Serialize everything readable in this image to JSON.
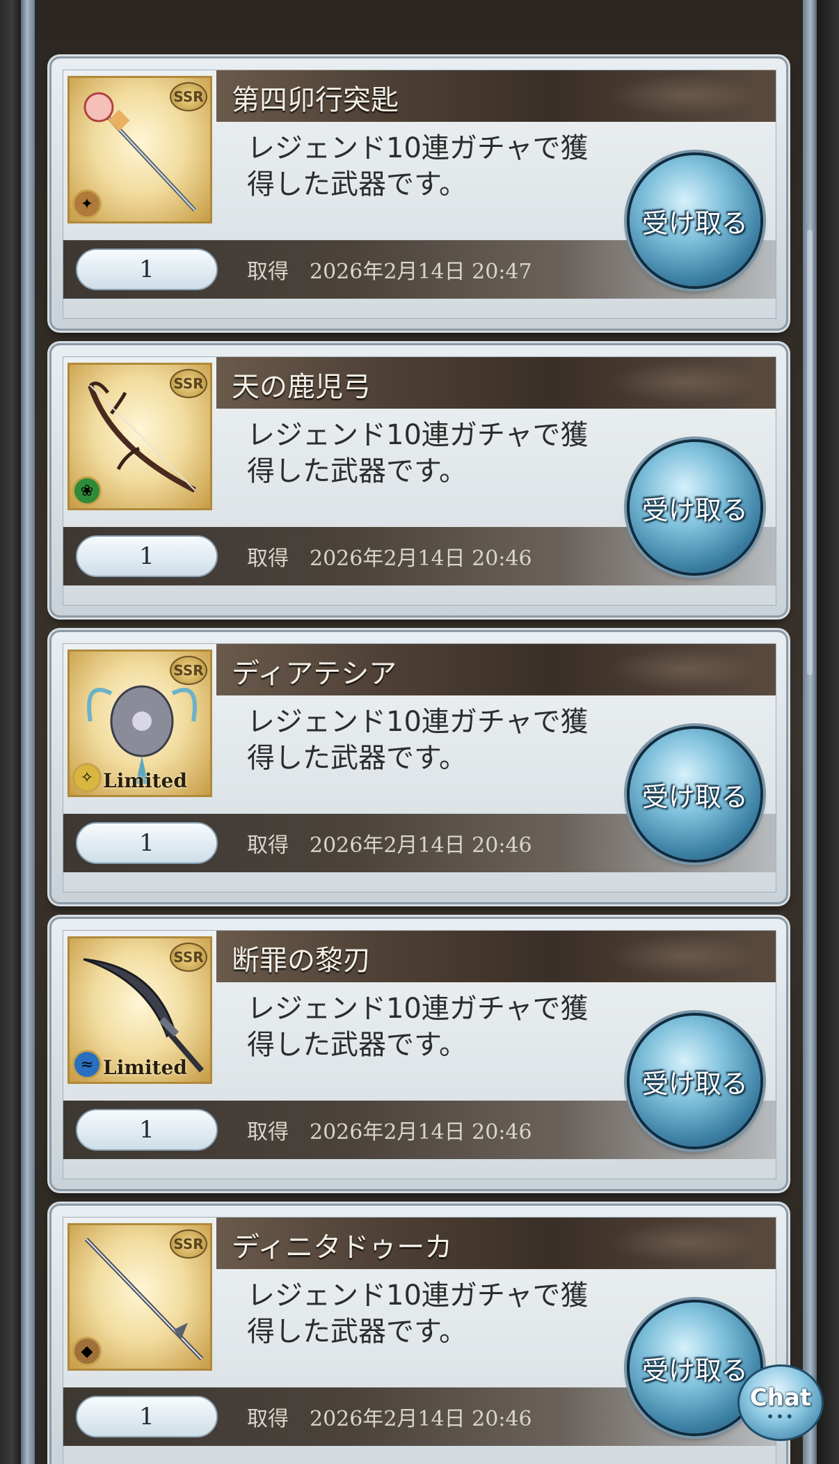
{
  "items": [
    {
      "name": "第四卯行突匙",
      "description_line1": "レジェンド10連ガチャで獲",
      "description_line2": "得した武器です。",
      "count": "1",
      "acquired_label": "取得",
      "acquired_date": "2026年2月14日 20:47",
      "rarity": "SSR",
      "element_icon": "fire-element-icon",
      "element_color": "#b07a3a",
      "limited_label": "",
      "receive_label": "受け取る"
    },
    {
      "name": "天の鹿児弓",
      "description_line1": "レジェンド10連ガチャで獲",
      "description_line2": "得した武器です。",
      "count": "1",
      "acquired_label": "取得",
      "acquired_date": "2026年2月14日 20:46",
      "rarity": "SSR",
      "element_icon": "wind-element-icon",
      "element_color": "#2f8a3a",
      "limited_label": "",
      "receive_label": "受け取る"
    },
    {
      "name": "ディアテシア",
      "description_line1": "レジェンド10連ガチャで獲",
      "description_line2": "得した武器です。",
      "count": "1",
      "acquired_label": "取得",
      "acquired_date": "2026年2月14日 20:46",
      "rarity": "SSR",
      "element_icon": "light-element-icon",
      "element_color": "#d8b640",
      "limited_label": "Limited",
      "receive_label": "受け取る"
    },
    {
      "name": "断罪の黎刃",
      "description_line1": "レジェンド10連ガチャで獲",
      "description_line2": "得した武器です。",
      "count": "1",
      "acquired_label": "取得",
      "acquired_date": "2026年2月14日 20:46",
      "rarity": "SSR",
      "element_icon": "water-element-icon",
      "element_color": "#2a6fc0",
      "limited_label": "Limited",
      "receive_label": "受け取る"
    },
    {
      "name": "ディニタドゥーカ",
      "description_line1": "レジェンド10連ガチャで獲",
      "description_line2": "得した武器です。",
      "count": "1",
      "acquired_label": "取得",
      "acquired_date": "2026年2月14日 20:46",
      "rarity": "SSR",
      "element_icon": "earth-element-icon",
      "element_color": "#a0703a",
      "limited_label": "",
      "receive_label": "受け取る"
    }
  ],
  "chat": {
    "label": "Chat",
    "dots": "•••"
  }
}
